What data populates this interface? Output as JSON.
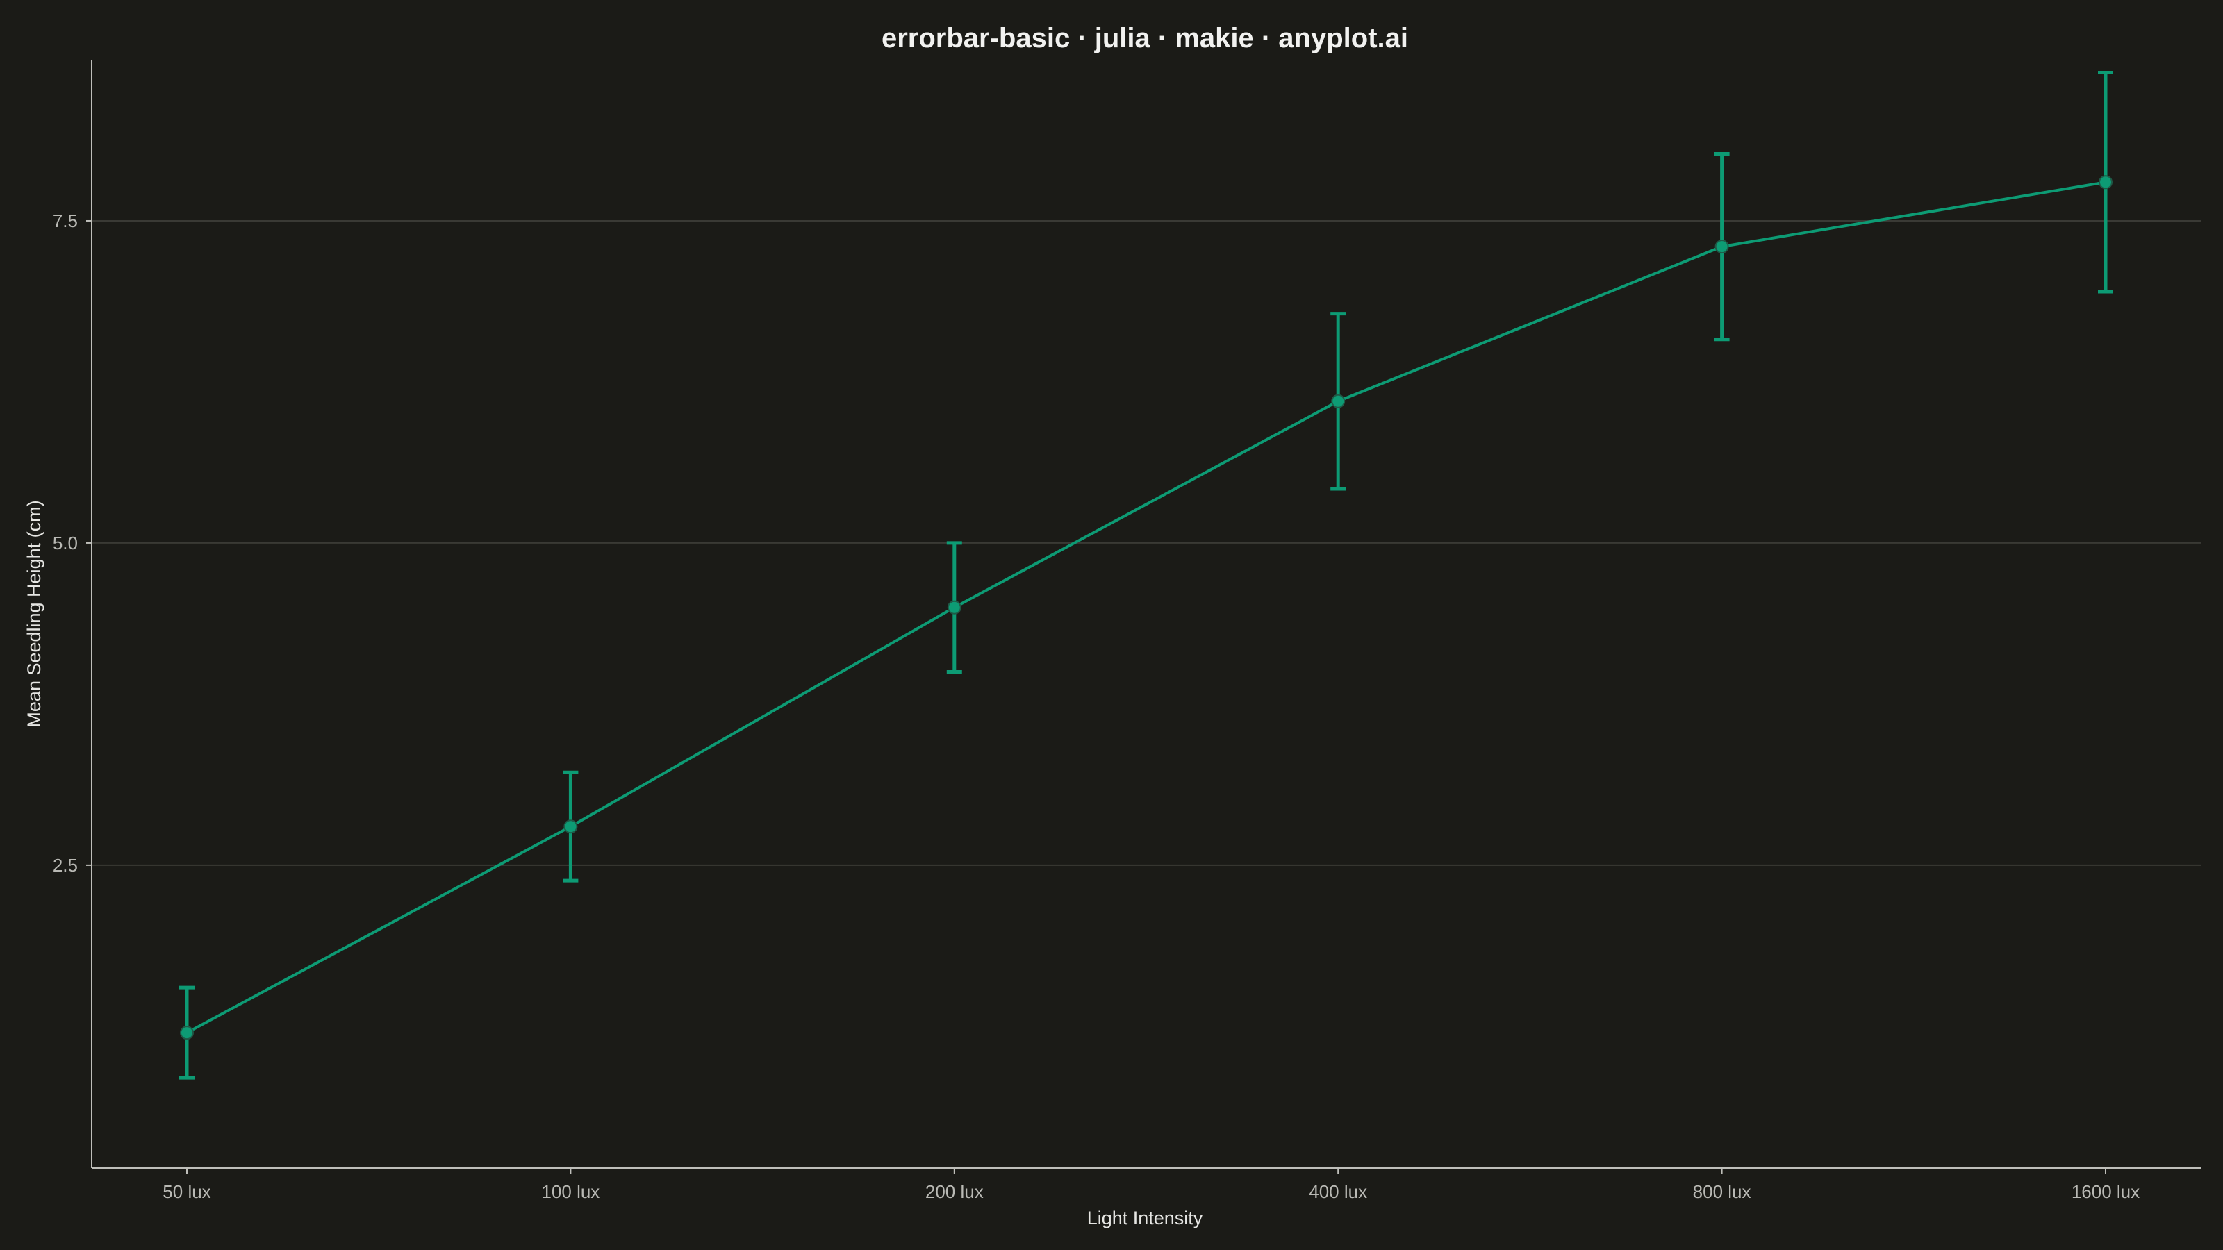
{
  "chart_data": {
    "type": "line",
    "title": "errorbar-basic · julia · makie · anyplot.ai",
    "xlabel": "Light Intensity",
    "ylabel": "Mean Seedling Height (cm)",
    "categories": [
      "50 lux",
      "100 lux",
      "200 lux",
      "400 lux",
      "800 lux",
      "1600 lux"
    ],
    "series": [
      {
        "values": [
          1.2,
          2.8,
          4.5,
          6.1,
          7.3,
          7.8
        ],
        "error": [
          0.35,
          0.42,
          0.5,
          0.68,
          0.72,
          0.85
        ]
      }
    ],
    "yticks": [
      2.5,
      5.0,
      7.5
    ],
    "ytick_labels": [
      "2.5",
      "5.0",
      "7.5"
    ],
    "ylim": [
      0.15,
      8.75
    ],
    "grid": "horizontal",
    "legend": "none",
    "colors": {
      "background": "#1b1b17",
      "series": "#0d9b74",
      "grid": "#3a3a35",
      "axis": "#bfbfba"
    }
  }
}
